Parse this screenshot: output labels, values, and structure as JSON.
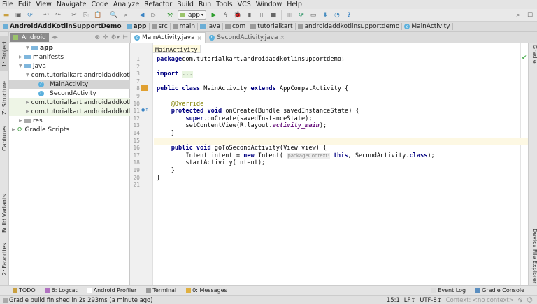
{
  "menu": [
    "File",
    "Edit",
    "View",
    "Navigate",
    "Code",
    "Analyze",
    "Refactor",
    "Build",
    "Run",
    "Tools",
    "VCS",
    "Window",
    "Help"
  ],
  "toolbar": {
    "run_config": "app"
  },
  "breadcrumbs": [
    "AndroidAddKotlinSupportDemo",
    "app",
    "src",
    "main",
    "java",
    "com",
    "tutorialkart",
    "androidaddkotlinsupportdemo",
    "MainActivity"
  ],
  "left_strip": {
    "project": "1: Project",
    "structure": "Z: Structure",
    "captures": "Captures",
    "build_variants": "Build Variants",
    "favorites": "2: Favorites"
  },
  "right_strip": {
    "gradle": "Gradle",
    "device_explorer": "Device File Explorer"
  },
  "project_panel": {
    "view_mode": "Android",
    "tree": [
      {
        "label": "app",
        "bold": true
      },
      {
        "label": "manifests"
      },
      {
        "label": "java"
      },
      {
        "label": "com.tutorialkart.androidaddkotlinsupportdemo"
      },
      {
        "label": "MainActivity",
        "selected": true
      },
      {
        "label": "SecondActivity"
      },
      {
        "label": "com.tutorialkart.androidaddkotlinsupportdemo (androidTest)"
      },
      {
        "label": "com.tutorialkart.androidaddkotlinsupportdemo (test)"
      },
      {
        "label": "res"
      },
      {
        "label": "Gradle Scripts"
      }
    ]
  },
  "tabs": [
    {
      "label": "MainActivity.java",
      "active": true
    },
    {
      "label": "SecondActivity.java",
      "active": false
    }
  ],
  "editor": {
    "tooltip": "MainActivity",
    "current_line": "15",
    "lines": [
      {
        "n": "1",
        "tokens": [
          [
            "kw",
            "package"
          ],
          [
            "",
            "com.tutorialkart.androidaddkotlinsupportdemo;"
          ]
        ]
      },
      {
        "n": "2",
        "tokens": []
      },
      {
        "n": "3",
        "tokens": [
          [
            "kw",
            "import"
          ],
          [
            "",
            " "
          ],
          [
            "fd",
            "..."
          ]
        ]
      },
      {
        "n": "7",
        "tokens": []
      },
      {
        "n": "8",
        "tokens": [
          [
            "kw",
            "public class"
          ],
          [
            "",
            " MainActivity "
          ],
          [
            "kw",
            "extends"
          ],
          [
            "",
            " AppCompatActivity {"
          ]
        ]
      },
      {
        "n": "9",
        "tokens": []
      },
      {
        "n": "10",
        "tokens": [
          [
            "",
            "    "
          ],
          [
            "an",
            "@Override"
          ]
        ]
      },
      {
        "n": "11",
        "tokens": [
          [
            "",
            "    "
          ],
          [
            "kw",
            "protected void"
          ],
          [
            "",
            " onCreate(Bundle savedInstanceState) {"
          ]
        ]
      },
      {
        "n": "12",
        "tokens": [
          [
            "",
            "        "
          ],
          [
            "kw",
            "super"
          ],
          [
            "",
            ".onCreate(savedInstanceState);"
          ]
        ]
      },
      {
        "n": "13",
        "tokens": [
          [
            "",
            "        setContentView(R.layout."
          ],
          [
            "it",
            "activity_main"
          ],
          [
            "",
            ");"
          ]
        ]
      },
      {
        "n": "14",
        "tokens": [
          [
            "",
            "    }"
          ]
        ]
      },
      {
        "n": "15",
        "tokens": []
      },
      {
        "n": "16",
        "tokens": [
          [
            "",
            "    "
          ],
          [
            "kw",
            "public void"
          ],
          [
            "",
            " goToSecondActivity(View view) {"
          ]
        ]
      },
      {
        "n": "17",
        "tokens": [
          [
            "",
            "        Intent intent = "
          ],
          [
            "kw",
            "new"
          ],
          [
            "",
            " Intent( "
          ],
          [
            "hint",
            "packageContext:"
          ],
          [
            "",
            " "
          ],
          [
            "kw",
            "this"
          ],
          [
            "",
            ", SecondActivity."
          ],
          [
            "kw",
            "class"
          ],
          [
            "",
            ");"
          ]
        ]
      },
      {
        "n": "18",
        "tokens": [
          [
            "",
            "        startActivity(intent);"
          ]
        ]
      },
      {
        "n": "19",
        "tokens": [
          [
            "",
            "    }"
          ]
        ]
      },
      {
        "n": "20",
        "tokens": [
          [
            "",
            "}"
          ]
        ]
      },
      {
        "n": "21",
        "tokens": []
      }
    ]
  },
  "bottom_tools": {
    "left": [
      "TODO",
      "6: Logcat",
      "Android Profiler",
      "Terminal",
      "0: Messages"
    ],
    "right": [
      "Event Log",
      "Gradle Console"
    ]
  },
  "status": {
    "message": "Gradle build finished in 2s 293ms (a minute ago)",
    "position": "15:1",
    "line_sep": "LF↕",
    "encoding": "UTF-8↕",
    "context": "Context: <no context>"
  },
  "colors": {
    "keyword": "#000080",
    "annotation": "#808000",
    "field": "#660e7a",
    "selection": "#d4d4d4",
    "current_line": "#fdf8e3"
  }
}
